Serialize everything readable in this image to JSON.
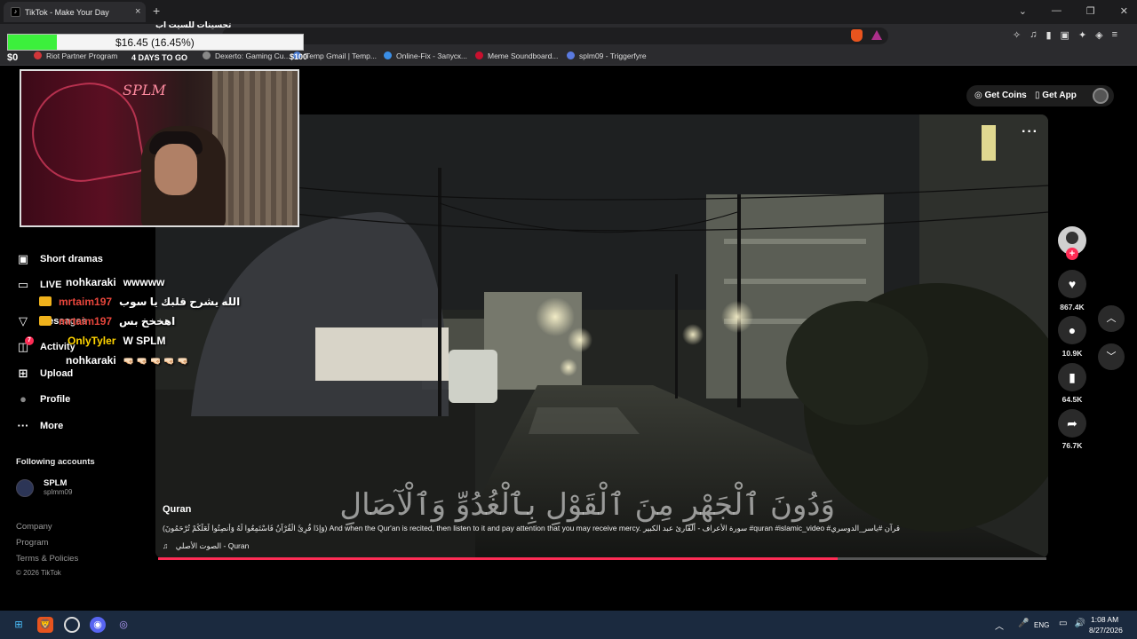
{
  "browser": {
    "tab_title": "TikTok - Make Your Day",
    "tab_icon": "tiktok-icon",
    "tab_close": "×",
    "new_tab": "+",
    "window_controls": [
      "⌄",
      "—",
      "❐",
      "✕"
    ],
    "address": "",
    "bookmarks": [
      {
        "label": "Riot Partner Program",
        "color": "#d13639"
      },
      {
        "label": "Dexerto: Gaming Cu...",
        "color": "#888888"
      },
      {
        "label": "Temp Gmail | Temp...",
        "color": "#4a7bd0"
      },
      {
        "label": "Online-Fix - Запуск...",
        "color": "#3a8ee6"
      },
      {
        "label": "Meme Soundboard...",
        "color": "#c8102e"
      },
      {
        "label": "splm09 - Triggerfyre",
        "color": "#5a7ae0"
      }
    ]
  },
  "stream_overlay": {
    "stock_top_label": "تحسينات للسيت اب",
    "stock_value": "$16.45 (16.45%)",
    "stock_progress_pct": 16.45,
    "stock_left": "$0",
    "stock_mid": "4 DAYS TO GO",
    "stock_right": "$100",
    "chat": [
      {
        "user": "nohkaraki",
        "message": "wwwww",
        "color": "#ffffff",
        "badge": false
      },
      {
        "user": "mrtaim197",
        "message": "الله يشرح قلبك يا سوب",
        "color": "#e8463c",
        "badge": true
      },
      {
        "user": "mrtaim197",
        "message": "اهخخخ بس",
        "color": "#e8463c",
        "badge": true
      },
      {
        "user": "OnlyTyler",
        "message": "W SPLM",
        "color": "#ffd400",
        "badge": false
      },
      {
        "user": "nohkaraki",
        "message": "🤜🏻 🤜🏻 🤜🏻 🤜🏻 🤜🏻",
        "color": "#ffffff",
        "badge": false
      }
    ]
  },
  "sidebar": {
    "items": [
      {
        "label": "Short dramas",
        "icon": "short-dramas-icon",
        "glyph": "▣"
      },
      {
        "label": "LIVE",
        "icon": "live-icon",
        "glyph": "▭"
      },
      {
        "label": "Messages",
        "icon": "messages-icon",
        "glyph": "▽"
      },
      {
        "label": "Activity",
        "icon": "activity-icon",
        "glyph": "◫",
        "badge": "7"
      },
      {
        "label": "Upload",
        "icon": "upload-icon",
        "glyph": "⊞"
      },
      {
        "label": "Profile",
        "icon": "profile-icon",
        "glyph": "●"
      },
      {
        "label": "More",
        "icon": "more-icon",
        "glyph": "···"
      }
    ],
    "following_title": "Following accounts",
    "following": [
      {
        "name": "SPLM",
        "handle": "splmm09"
      }
    ],
    "footer_links": [
      "Company",
      "Program",
      "Terms & Policies"
    ],
    "copyright": "© 2026 TikTok"
  },
  "header": {
    "get_coins": "Get Coins",
    "get_app": "Get App"
  },
  "video": {
    "more_glyph": "···",
    "arabic_subtitle": "وَدُونَ ٱلْجَهْرِ مِنَ ٱلْقَوْلِ بِٱلْغُدُوِّ وَٱلْآصَالِ",
    "progress_pct": 76.5,
    "caption_title": "Quran",
    "caption_desc": "(وَإِذَا قُرِئَ الْقُرْآنُ فَاسْتَمِعُوا لَهُ وَأَنصِتُوا لَعَلَّكُمْ تُرْحَمُونَ) And when the Qur'an is recited, then listen to it and pay attention that you may receive mercy. سورة الأعراف - القارئ عبد الكبير #quran #islamic_video #قرآن #ياسر_الدوسري",
    "music": "الصوت الأصلي - Quran",
    "music_glyph": "♫"
  },
  "actions": {
    "likes": "867.4K",
    "comments": "10.9K",
    "saves": "64.5K",
    "shares": "76.7K"
  },
  "taskbar": {
    "lang": "ENG",
    "time": "1:08 AM",
    "date": "8/27/2026"
  },
  "colors": {
    "accent": "#fe2c55",
    "stock_fill": "#3cf03c"
  }
}
